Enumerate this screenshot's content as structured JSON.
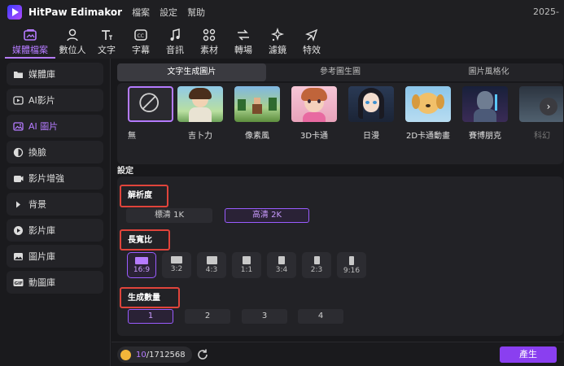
{
  "titlebar": {
    "app_name": "HitPaw Edimakor",
    "menus": [
      "檔案",
      "設定",
      "幫助"
    ],
    "date": "2025-"
  },
  "toolbar": {
    "items": [
      {
        "label": "媒體檔案",
        "icon": "media-icon"
      },
      {
        "label": "數位人",
        "icon": "avatar-icon"
      },
      {
        "label": "文字",
        "icon": "text-icon"
      },
      {
        "label": "字幕",
        "icon": "caption-icon"
      },
      {
        "label": "音訊",
        "icon": "music-icon"
      },
      {
        "label": "素材",
        "icon": "elements-icon"
      },
      {
        "label": "轉場",
        "icon": "transition-icon"
      },
      {
        "label": "濾鏡",
        "icon": "filter-icon"
      },
      {
        "label": "特效",
        "icon": "effects-icon"
      }
    ]
  },
  "sidebar": {
    "items": [
      {
        "label": "媒體庫",
        "icon": "folder-icon"
      },
      {
        "label": "AI影片",
        "icon": "ai-video-icon"
      },
      {
        "label": "AI 圖片",
        "icon": "ai-image-icon",
        "active": true
      },
      {
        "label": "換臉",
        "icon": "face-swap-icon"
      },
      {
        "label": "影片增強",
        "icon": "video-enhance-icon"
      },
      {
        "label": "背景",
        "icon": "play-triangle-icon"
      },
      {
        "label": "影片庫",
        "icon": "video-library-icon"
      },
      {
        "label": "圖片庫",
        "icon": "image-library-icon"
      },
      {
        "label": "動圖庫",
        "icon": "gif-icon"
      }
    ]
  },
  "tabs": [
    "文字生成圖片",
    "參考圖生圖",
    "圖片風格化"
  ],
  "styles": [
    {
      "label": "無",
      "selected": true
    },
    {
      "label": "吉卜力"
    },
    {
      "label": "像素風"
    },
    {
      "label": "3D卡通"
    },
    {
      "label": "日漫"
    },
    {
      "label": "2D卡通動畫"
    },
    {
      "label": "賽博朋克"
    },
    {
      "label": "科幻"
    }
  ],
  "settings": {
    "title": "設定",
    "resolution": {
      "label": "解析度",
      "options": [
        "標清 1K",
        "高清 2K"
      ],
      "selected": "高清 2K"
    },
    "aspect": {
      "label": "長寬比",
      "options": [
        "16:9",
        "3:2",
        "4:3",
        "1:1",
        "3:4",
        "2:3",
        "9:16"
      ],
      "selected": "16:9"
    },
    "count": {
      "label": "生成數量",
      "options": [
        "1",
        "2",
        "3",
        "4"
      ],
      "selected": "1"
    }
  },
  "footer": {
    "credits_used": "10",
    "credits_total": "/1712568",
    "generate_label": "產生"
  },
  "colors": {
    "accent": "#b57bff",
    "highlight_box": "#e0443b",
    "generate": "#8a3ff0"
  }
}
